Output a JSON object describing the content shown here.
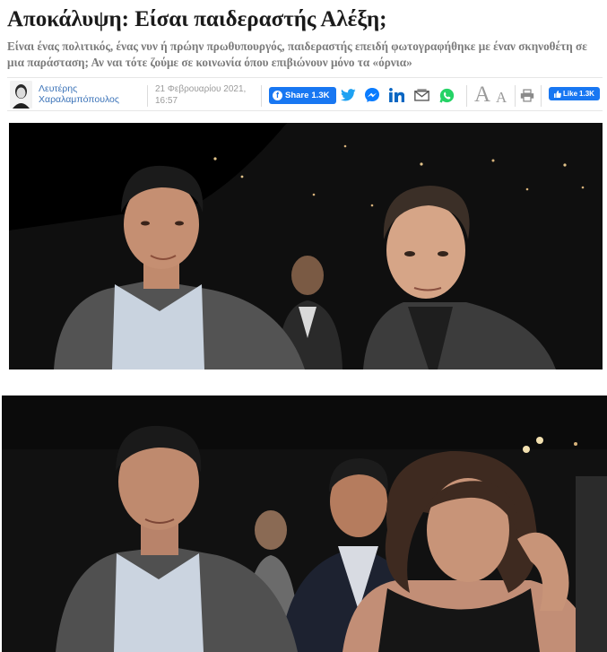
{
  "article": {
    "title": "Αποκάλυψη: Είσαι παιδεραστής Αλέξη;",
    "lead": "Είναι ένας πολιτικός, ένας νυν ή πρώην πρωθυπουργός, παιδεραστής επειδή φωτογραφήθηκε με έναν σκηνοθέτη σε μια παράσταση; Αν ναι τότε ζούμε σε κοινωνία όπου επιβιώνουν μόνο τα «όρνια»"
  },
  "meta": {
    "author_line1": "Λευτέρης",
    "author_line2": "Χαραλαμπόπουλος",
    "date_line1": "21 Φεβρουαρίου 2021,",
    "date_line2": "16:57"
  },
  "share": {
    "facebook_label": "Share",
    "facebook_count": "1.3K",
    "like_label": "Like",
    "like_count": "1.3K",
    "font_large": "A",
    "font_small": "A"
  },
  "colors": {
    "facebook": "#1877f2",
    "twitter": "#1da1f2",
    "messenger": "#0a7cff",
    "linkedin": "#0a66c2",
    "whatsapp": "#25d366",
    "author_link": "#3b73b8"
  },
  "icons": [
    "twitter-icon",
    "messenger-icon",
    "linkedin-icon",
    "email-icon",
    "whatsapp-icon",
    "print-icon",
    "facebook-icon",
    "thumbs-up-icon"
  ]
}
